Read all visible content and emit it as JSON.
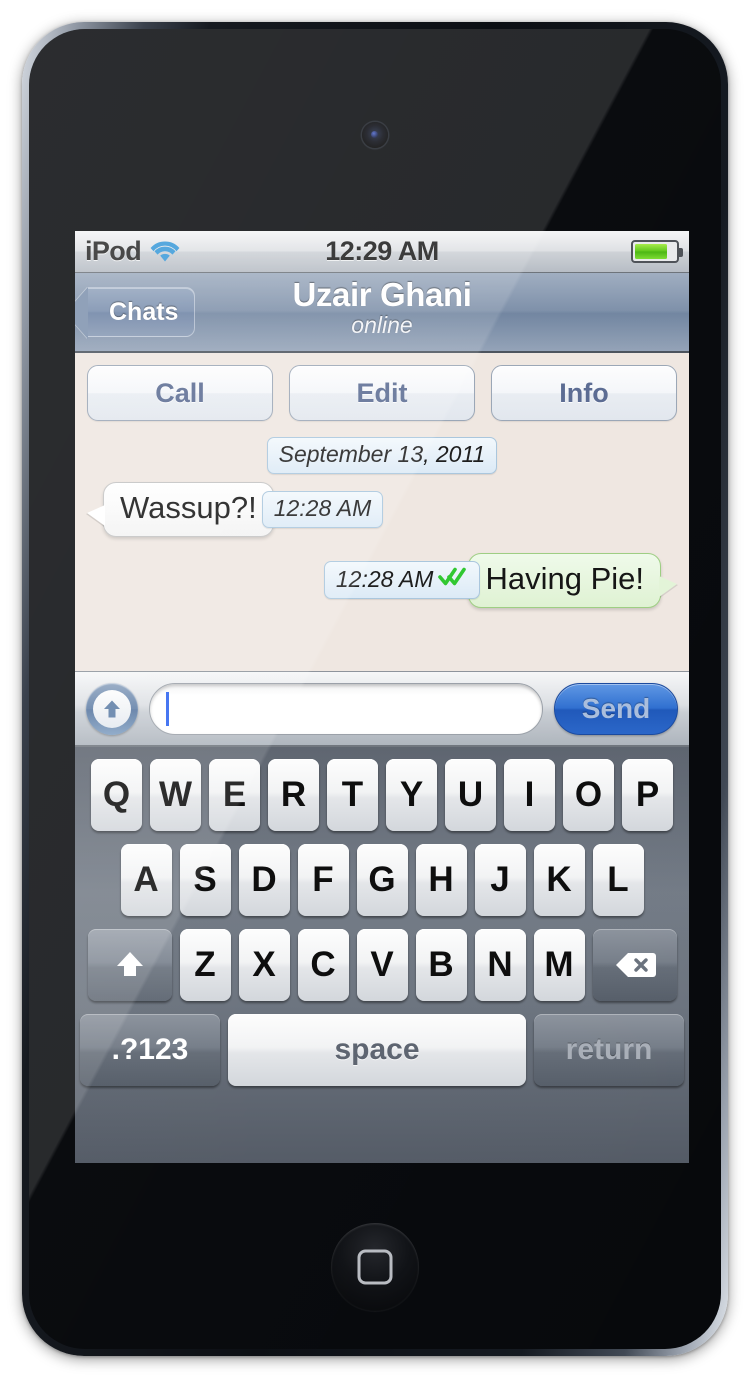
{
  "status_bar": {
    "carrier": "iPod",
    "wifi_icon": "wifi-icon",
    "time": "12:29 AM",
    "battery_icon": "battery-icon",
    "battery_level_percent": 80
  },
  "nav_bar": {
    "back_label": "Chats",
    "back_icon": "chevron-left-icon",
    "title": "Uzair Ghani",
    "subtitle": "online"
  },
  "action_bar": {
    "buttons": [
      {
        "label": "Call"
      },
      {
        "label": "Edit"
      },
      {
        "label": "Info"
      }
    ]
  },
  "conversation": {
    "date_separator": "September 13, 2011",
    "messages": [
      {
        "direction": "incoming",
        "text": "Wassup?!",
        "time": "12:28 AM",
        "read_receipt": false
      },
      {
        "direction": "outgoing",
        "text": "Having Pie!",
        "time": "12:28 AM",
        "read_receipt": true,
        "read_receipt_icon": "double-check-icon"
      }
    ]
  },
  "input_bar": {
    "attach_icon": "arrow-up-circle-icon",
    "text_value": "",
    "placeholder": "",
    "send_label": "Send"
  },
  "keyboard": {
    "row1": [
      "Q",
      "W",
      "E",
      "R",
      "T",
      "Y",
      "U",
      "I",
      "O",
      "P"
    ],
    "row2": [
      "A",
      "S",
      "D",
      "F",
      "G",
      "H",
      "J",
      "K",
      "L"
    ],
    "row3": [
      "Z",
      "X",
      "C",
      "V",
      "B",
      "N",
      "M"
    ],
    "shift_icon": "shift-arrow-up-icon",
    "backspace_icon": "backspace-delete-icon",
    "numbers_label": ".?123",
    "space_label": "space",
    "return_label": "return"
  },
  "device": {
    "home_button_icon": "home-rounded-square-icon",
    "camera_icon": "front-camera-icon"
  },
  "colors": {
    "nav_bar": "#7e90a9",
    "chat_background": "#efe7e1",
    "incoming_bubble": "#ffffff",
    "outgoing_bubble": "#e3f4d8",
    "time_pill": "#dceaf6",
    "send_button": "#2f6fd0",
    "read_receipt_green": "#2fc72f",
    "battery_green": "#5fc71c",
    "wifi_blue": "#3a9ad9"
  }
}
